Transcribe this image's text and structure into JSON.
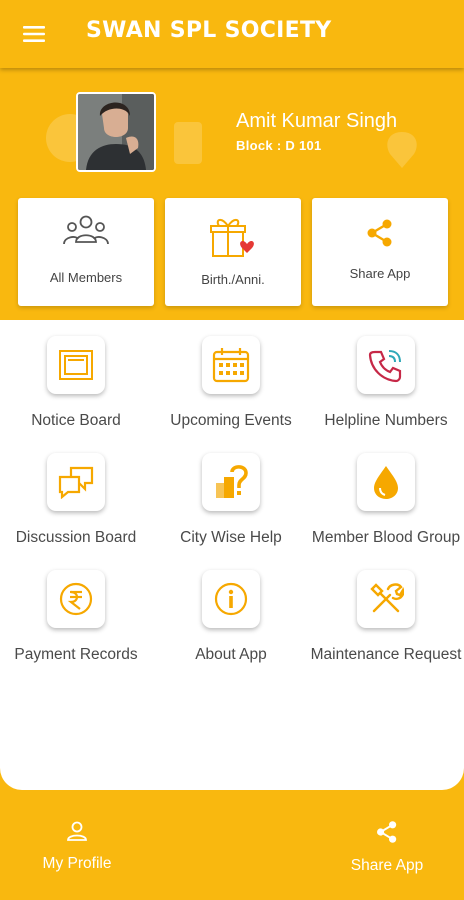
{
  "app": {
    "title": "SWAN SPL SOCIETY"
  },
  "profile": {
    "name": "Amit Kumar Singh",
    "block": "Block : D 101"
  },
  "quick_cards": [
    {
      "label": "All Members",
      "icon": "members-icon"
    },
    {
      "label": "Birth./Anni.",
      "icon": "gift-heart-icon"
    },
    {
      "label": "Share App",
      "icon": "share-icon"
    }
  ],
  "menu": [
    {
      "label": "Notice Board",
      "icon": "notice-board-icon"
    },
    {
      "label": "Upcoming Events",
      "icon": "calendar-icon"
    },
    {
      "label": "Helpline Numbers",
      "icon": "phone-ring-icon"
    },
    {
      "label": "Discussion Board",
      "icon": "chat-bubbles-icon"
    },
    {
      "label": "City Wise Help",
      "icon": "city-question-icon"
    },
    {
      "label": "Member Blood Group",
      "icon": "blood-drop-icon"
    },
    {
      "label": "Payment Records",
      "icon": "rupee-icon"
    },
    {
      "label": "About App",
      "icon": "info-icon"
    },
    {
      "label": "Maintenance Request",
      "icon": "tools-icon"
    }
  ],
  "bottom_nav": [
    {
      "label": "My Profile",
      "icon": "person-icon"
    },
    {
      "label": "Share App",
      "icon": "share-icon"
    }
  ],
  "colors": {
    "primary": "#F9B80F",
    "icon_orange": "#F6A800",
    "text_gray": "#4a4a4a",
    "card_bg": "#ffffff"
  }
}
